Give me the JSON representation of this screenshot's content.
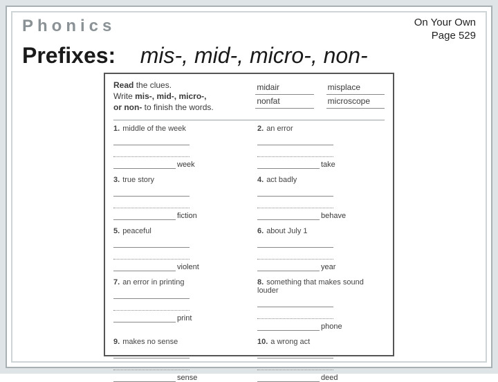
{
  "header": {
    "brand": "Phonics",
    "corner_line1": "On Your Own",
    "corner_line2": "Page 529"
  },
  "title": {
    "label": "Prefixes:",
    "italic": "mis-, mid-, micro-, non-"
  },
  "worksheet": {
    "instructions": {
      "line1_bold": "Read",
      "line1_rest": "the clues.",
      "line2a": "Write",
      "line2b": "mis-, mid-, micro-,",
      "line3a": "or non-",
      "line3b": "to finish the words."
    },
    "word_bank": [
      "midair",
      "misplace",
      "nonfat",
      "microscope"
    ],
    "items": [
      {
        "num": "1.",
        "clue": "middle of the week",
        "suffix": "week"
      },
      {
        "num": "2.",
        "clue": "an error",
        "suffix": "take"
      },
      {
        "num": "3.",
        "clue": "true story",
        "suffix": "fiction"
      },
      {
        "num": "4.",
        "clue": "act badly",
        "suffix": "behave"
      },
      {
        "num": "5.",
        "clue": "peaceful",
        "suffix": "violent"
      },
      {
        "num": "6.",
        "clue": "about July 1",
        "suffix": "year"
      },
      {
        "num": "7.",
        "clue": "an error in printing",
        "suffix": "print"
      },
      {
        "num": "8.",
        "clue": "something that makes sound louder",
        "suffix": "phone"
      },
      {
        "num": "9.",
        "clue": "makes no sense",
        "suffix": "sense"
      },
      {
        "num": "10.",
        "clue": "a wrong act",
        "suffix": "deed"
      }
    ]
  }
}
